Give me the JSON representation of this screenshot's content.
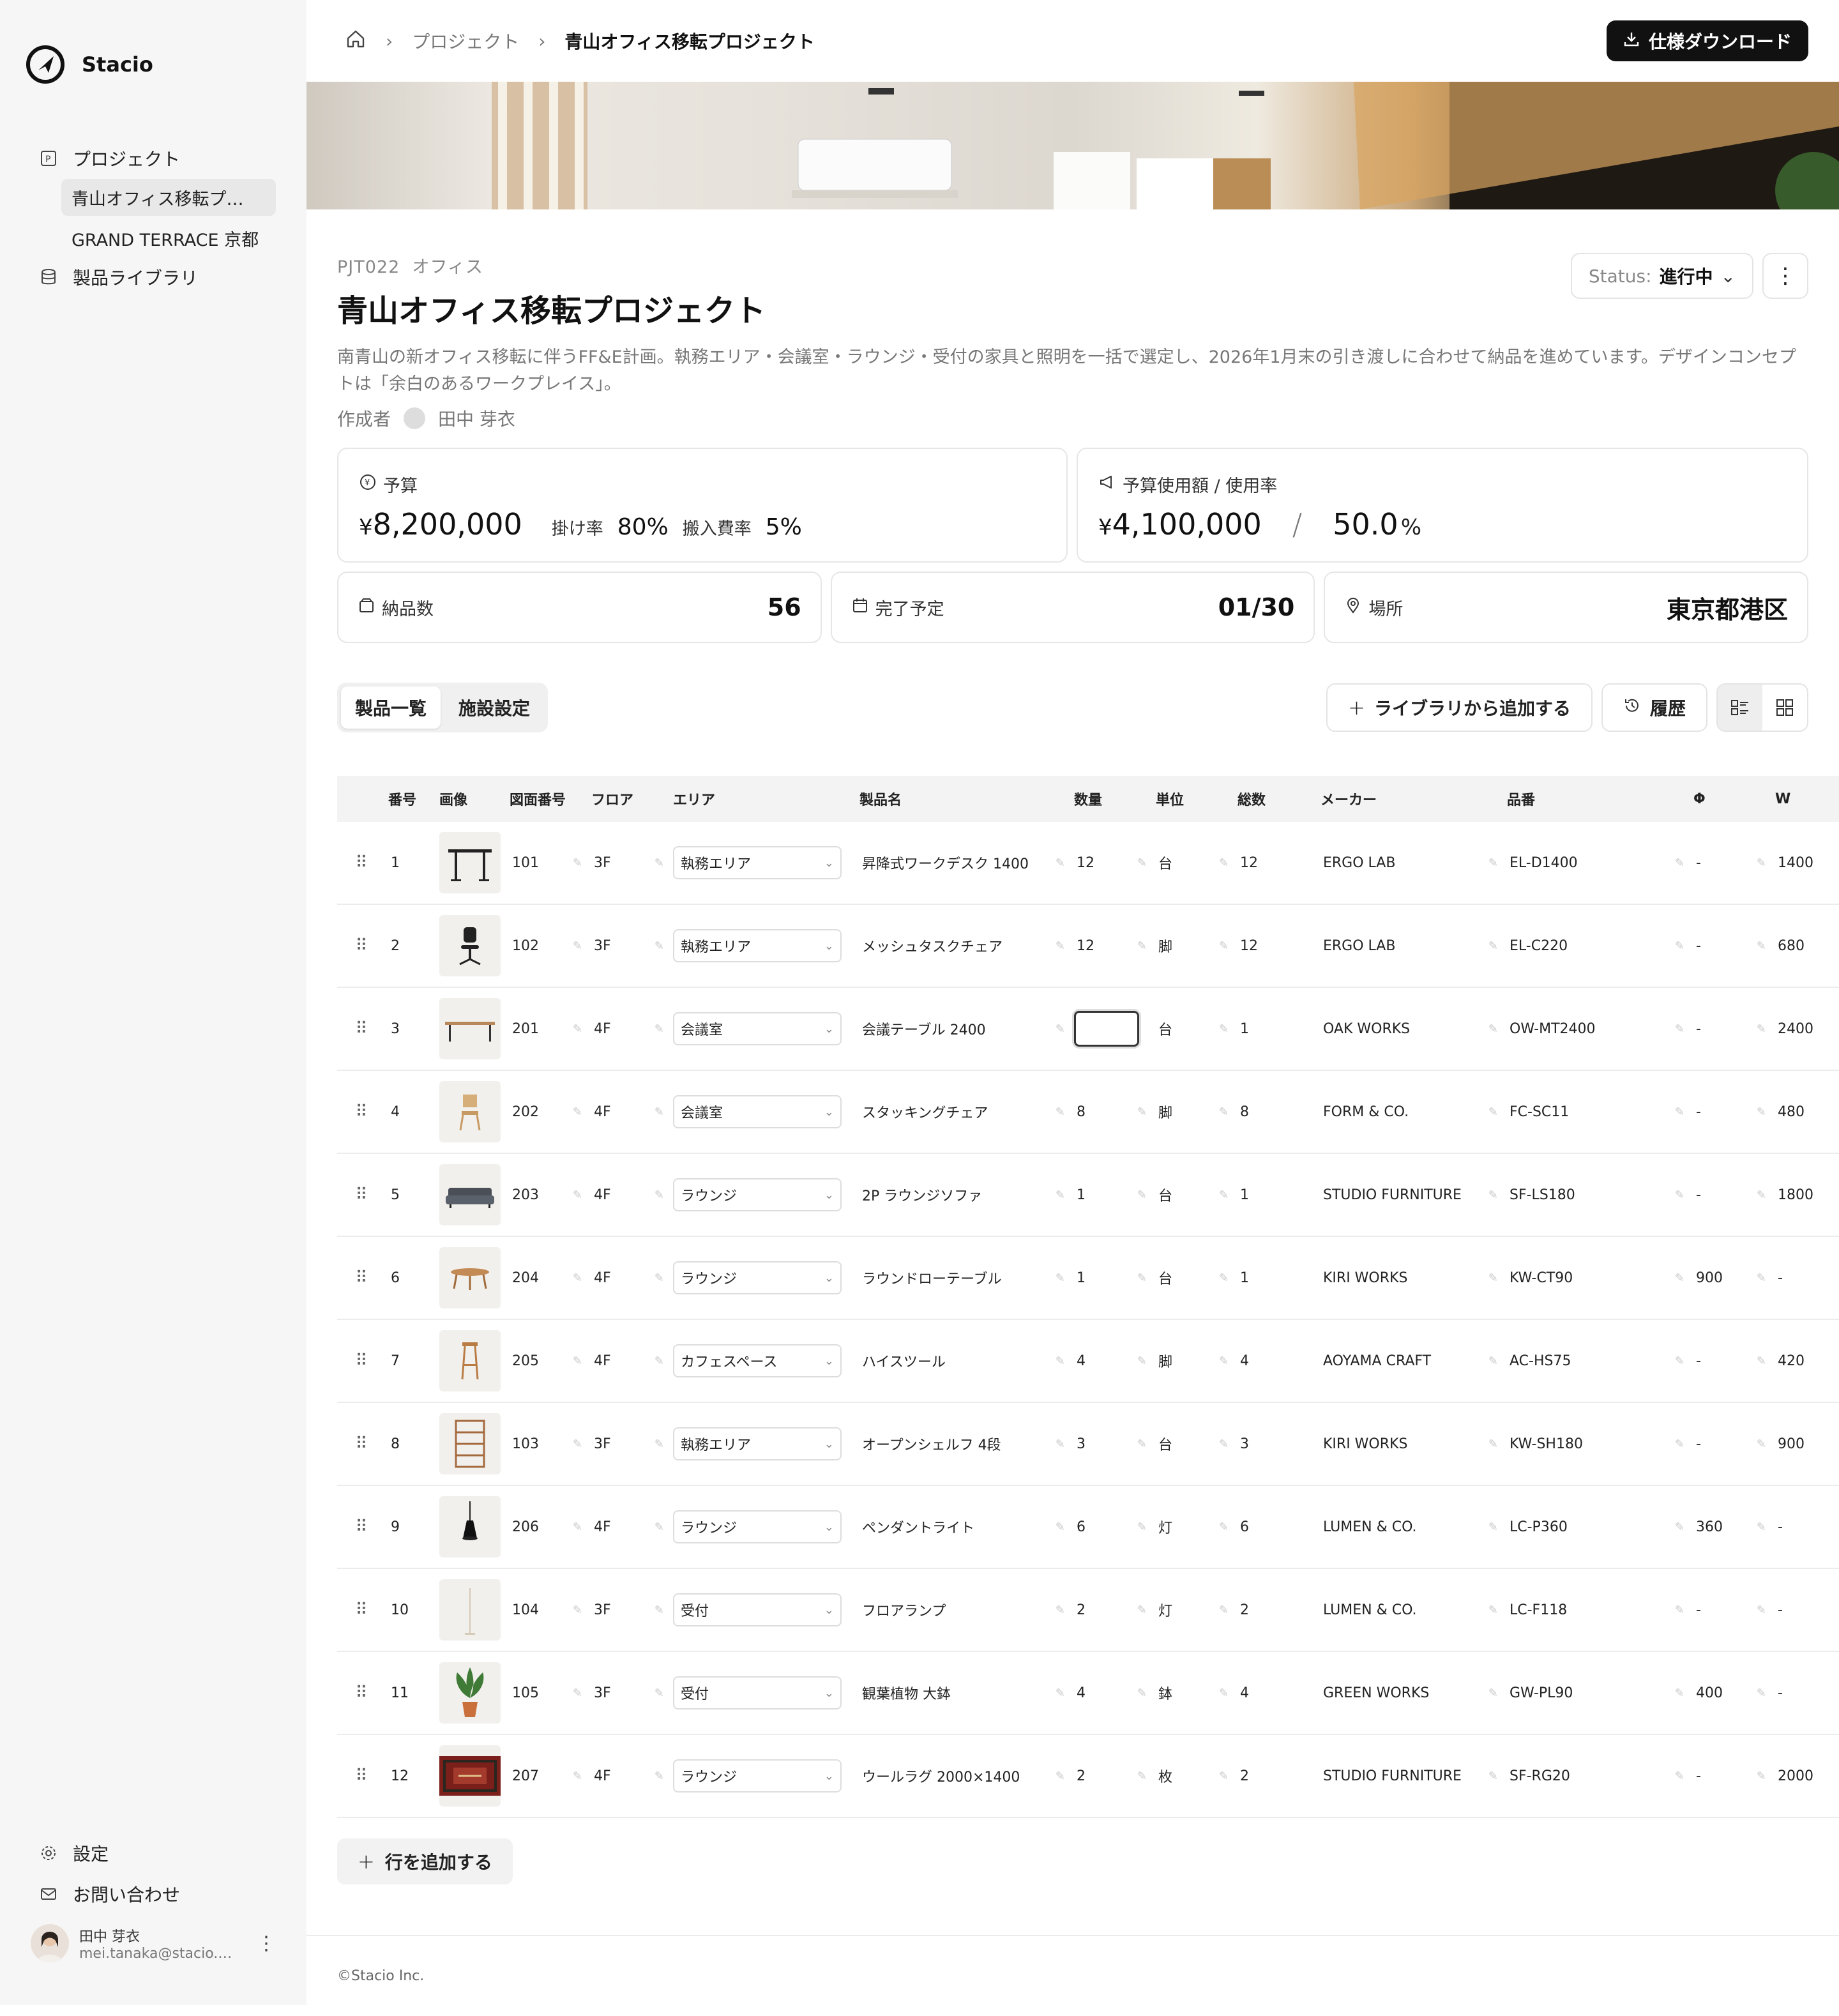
{
  "app": {
    "name": "Stacio"
  },
  "sidebar": {
    "projects_label": "プロジェクト",
    "sub_items": [
      {
        "label": "青山オフィス移転プ…",
        "active": true
      },
      {
        "label": "GRAND TERRACE 京都",
        "active": false
      }
    ],
    "library_label": "製品ライブラリ",
    "settings_label": "設定",
    "contact_label": "お問い合わせ",
    "user": {
      "name": "田中 芽衣",
      "email": "mei.tanaka@stacio.c…"
    }
  },
  "breadcrumb": {
    "items": [
      "プロジェクト",
      "青山オフィス移転プロジェクト"
    ]
  },
  "header": {
    "download_label": "仕様ダウンロード"
  },
  "project": {
    "code": "PJT022",
    "category": "オフィス",
    "title": "青山オフィス移転プロジェクト",
    "status_label": "Status:",
    "status_value": "進行中",
    "description": "南青山の新オフィス移転に伴うFF&E計画。執務エリア・会議室・ラウンジ・受付の家具と照明を一括で選定し、2026年1月末の引き渡しに合わせて納品を進めています。デザインコンセプトは「余白のあるワークプレイス」。",
    "author_label": "作成者",
    "author_name": "田中 芽衣"
  },
  "stats": {
    "budget": {
      "label": "予算",
      "currency": "¥",
      "value": "8,200,000",
      "rate_label": "掛け率",
      "rate": "80%",
      "carry_label": "搬入費率",
      "carry": "5%"
    },
    "usage": {
      "label": "予算使用額 / 使用率",
      "currency": "¥",
      "value": "4,100,000",
      "sep": "/",
      "percent": "50.0",
      "percent_unit": "%"
    },
    "items": {
      "label": "納品数",
      "value": "56"
    },
    "due": {
      "label": "完了予定",
      "value": "01/30"
    },
    "place": {
      "label": "場所",
      "value": "東京都港区"
    }
  },
  "toolbar": {
    "tabs": [
      "製品一覧",
      "施設設定"
    ],
    "add_library_label": "ライブラリから追加する",
    "history_label": "履歴"
  },
  "table": {
    "headers": [
      "番号",
      "画像",
      "図面番号",
      "フロア",
      "エリア",
      "製品名",
      "数量",
      "単位",
      "総数",
      "メーカー",
      "品番",
      "Φ",
      "W"
    ],
    "rows": [
      {
        "no": "1",
        "img": "desk",
        "dwg": "101",
        "floor": "3F",
        "area": "執務エリア",
        "name": "昇降式ワークデスク 1400",
        "qty": "12",
        "unit": "台",
        "total": "12",
        "maker": "ERGO LAB",
        "part": "EL-D1400",
        "phi": "-",
        "w": "1400"
      },
      {
        "no": "2",
        "img": "chair",
        "dwg": "102",
        "floor": "3F",
        "area": "執務エリア",
        "name": "メッシュタスクチェア",
        "qty": "12",
        "unit": "脚",
        "total": "12",
        "maker": "ERGO LAB",
        "part": "EL-C220",
        "phi": "-",
        "w": "680"
      },
      {
        "no": "3",
        "img": "table",
        "dwg": "201",
        "floor": "4F",
        "area": "会議室",
        "name": "会議テーブル 2400",
        "qty": "",
        "unit": "台",
        "total": "1",
        "maker": "OAK WORKS",
        "part": "OW-MT2400",
        "phi": "-",
        "w": "2400"
      },
      {
        "no": "4",
        "img": "stack-chair",
        "dwg": "202",
        "floor": "4F",
        "area": "会議室",
        "name": "スタッキングチェア",
        "qty": "8",
        "unit": "脚",
        "total": "8",
        "maker": "FORM & CO.",
        "part": "FC-SC11",
        "phi": "-",
        "w": "480"
      },
      {
        "no": "5",
        "img": "sofa",
        "dwg": "203",
        "floor": "4F",
        "area": "ラウンジ",
        "name": "2P ラウンジソファ",
        "qty": "1",
        "unit": "台",
        "total": "1",
        "maker": "STUDIO FURNITURE",
        "part": "SF-LS180",
        "phi": "-",
        "w": "1800"
      },
      {
        "no": "6",
        "img": "round-table",
        "dwg": "204",
        "floor": "4F",
        "area": "ラウンジ",
        "name": "ラウンドローテーブル",
        "qty": "1",
        "unit": "台",
        "total": "1",
        "maker": "KIRI WORKS",
        "part": "KW-CT90",
        "phi": "900",
        "w": "-"
      },
      {
        "no": "7",
        "img": "stool",
        "dwg": "205",
        "floor": "4F",
        "area": "カフェスペース",
        "name": "ハイスツール",
        "qty": "4",
        "unit": "脚",
        "total": "4",
        "maker": "AOYAMA CRAFT",
        "part": "AC-HS75",
        "phi": "-",
        "w": "420"
      },
      {
        "no": "8",
        "img": "shelf",
        "dwg": "103",
        "floor": "3F",
        "area": "執務エリア",
        "name": "オープンシェルフ 4段",
        "qty": "3",
        "unit": "台",
        "total": "3",
        "maker": "KIRI WORKS",
        "part": "KW-SH180",
        "phi": "-",
        "w": "900"
      },
      {
        "no": "9",
        "img": "pendant",
        "dwg": "206",
        "floor": "4F",
        "area": "ラウンジ",
        "name": "ペンダントライト",
        "qty": "6",
        "unit": "灯",
        "total": "6",
        "maker": "LUMEN & CO.",
        "part": "LC-P360",
        "phi": "360",
        "w": "-"
      },
      {
        "no": "10",
        "img": "floor-lamp",
        "dwg": "104",
        "floor": "3F",
        "area": "受付",
        "name": "フロアランプ",
        "qty": "2",
        "unit": "灯",
        "total": "2",
        "maker": "LUMEN & CO.",
        "part": "LC-F118",
        "phi": "-",
        "w": "-"
      },
      {
        "no": "11",
        "img": "plant",
        "dwg": "105",
        "floor": "3F",
        "area": "受付",
        "name": "観葉植物 大鉢",
        "qty": "4",
        "unit": "鉢",
        "total": "4",
        "maker": "GREEN WORKS",
        "part": "GW-PL90",
        "phi": "400",
        "w": "-"
      },
      {
        "no": "12",
        "img": "rug",
        "dwg": "207",
        "floor": "4F",
        "area": "ラウンジ",
        "name": "ウールラグ 2000×1400",
        "qty": "2",
        "unit": "枚",
        "total": "2",
        "maker": "STUDIO FURNITURE",
        "part": "SF-RG20",
        "phi": "-",
        "w": "2000"
      }
    ],
    "add_row_label": "行を追加する"
  },
  "footer": {
    "copyright": "©Stacio Inc."
  },
  "colors": {
    "primary": "#111111",
    "sidebar_bg": "#f6f6f6",
    "border": "#e6e6e6"
  }
}
